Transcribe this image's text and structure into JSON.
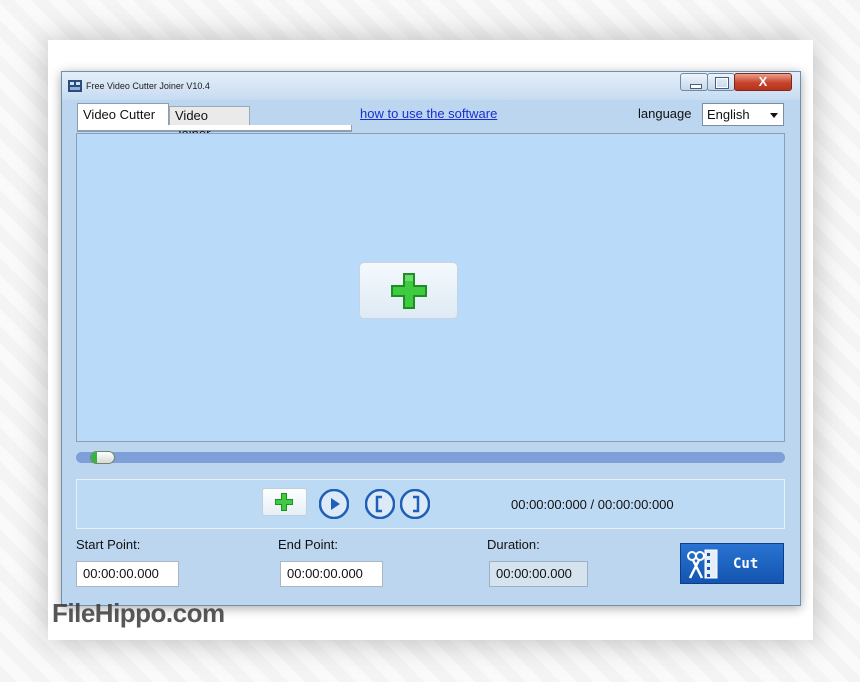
{
  "window": {
    "title": "Free Video Cutter Joiner V10.4",
    "close_glyph": "X"
  },
  "tabs": [
    {
      "label": "Video Cutter",
      "active": true
    },
    {
      "label": "Video Joiner",
      "active": false
    }
  ],
  "help_link": "how to use the software",
  "language": {
    "label": "language",
    "selected": "English"
  },
  "player": {
    "progress_fraction": 0.02,
    "time_display": "00:00:00:000 / 00:00:00:000"
  },
  "fields": {
    "start_label": "Start Point:",
    "start_value": "00:00:00.000",
    "end_label": "End Point:",
    "end_value": "00:00:00.000",
    "duration_label": "Duration:",
    "duration_value": "00:00:00.000"
  },
  "cut_button": {
    "label": "Cut",
    "icon": "scissors-film-icon"
  },
  "icons": {
    "add_video": "green-plus-icon",
    "play": "play-icon",
    "mark_start": "bracket-left-icon",
    "mark_end": "bracket-right-icon"
  },
  "colors": {
    "window_bg": "#bcd6ef",
    "video_area": "#b9daf8",
    "accent_blue": "#1f63c2",
    "plus_green": "#2fb534",
    "link": "#1a2fd1"
  },
  "watermark": "FileHippo.com"
}
